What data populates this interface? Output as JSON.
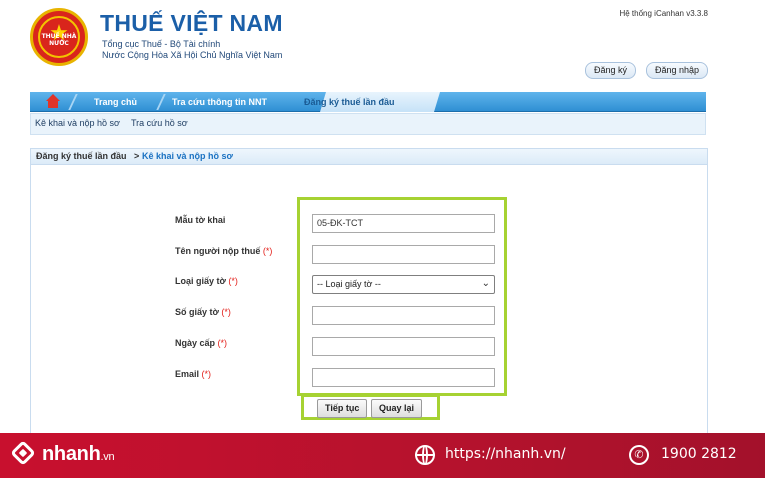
{
  "header": {
    "title": "THUẾ VIỆT NAM",
    "subtitle1": "Tổng cục Thuế - Bộ Tài chính",
    "subtitle2": "Nước Cộng Hòa Xã Hội Chủ Nghĩa Việt Nam",
    "emblem_text": "THUẾ NHÀ NƯỚC",
    "system_version": "Hệ thống iCanhan v3.3.8",
    "register_label": "Đăng ký",
    "login_label": "Đăng nhập"
  },
  "nav": {
    "items": [
      "Trang chủ",
      "Tra cứu thông tin NNT",
      "Đăng ký thuế lần đầu"
    ],
    "active_index": 2
  },
  "subnav": {
    "items": [
      "Kê khai và nộp hồ sơ",
      "Tra cứu hồ sơ"
    ]
  },
  "breadcrumb": {
    "parent": "Đăng ký thuế lần đầu",
    "separator": ">",
    "current": "Kê khai và nộp hồ sơ"
  },
  "form": {
    "required_mark": "(*)",
    "fields": [
      {
        "label": "Mẫu tờ khai",
        "required": false,
        "value": "05-ĐK-TCT"
      },
      {
        "label": "Tên người nộp thuế",
        "required": true,
        "value": ""
      },
      {
        "label": "Loại giấy tờ",
        "required": true,
        "value": "-- Loại giấy tờ --"
      },
      {
        "label": "Số giấy tờ",
        "required": true,
        "value": ""
      },
      {
        "label": "Ngày cấp",
        "required": true,
        "value": ""
      },
      {
        "label": "Email",
        "required": true,
        "value": ""
      }
    ],
    "next_label": "Tiếp tục",
    "back_label": "Quay lại"
  },
  "banner": {
    "logo": "nhanh",
    "logo_tld": ".vn",
    "url": "https://nhanh.vn/",
    "phone": "1900 2812"
  },
  "colors": {
    "brand_blue": "#1b5fa8",
    "nav_blue": "#2f8fd3",
    "highlight_green": "#a6d232",
    "banner_red": "#c8102e",
    "required_red": "#e3201b"
  }
}
